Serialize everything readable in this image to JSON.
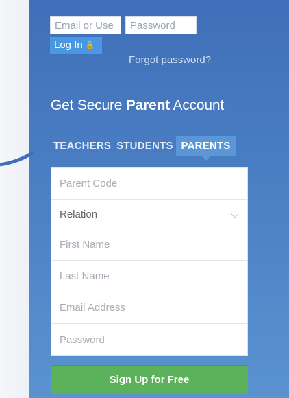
{
  "login": {
    "email_placeholder": "Email or Use",
    "password_placeholder": "Password",
    "login_label": "Log In",
    "lock_icon": "lock-icon",
    "forgot_label": "Forgot password?"
  },
  "heading": {
    "prefix": "Get Secure ",
    "emphasis": "Parent",
    "suffix": " Account"
  },
  "tabs": [
    {
      "label": "TEACHERS",
      "active": false
    },
    {
      "label": "STUDENTS",
      "active": false
    },
    {
      "label": "PARENTS",
      "active": true
    }
  ],
  "form": {
    "parent_code_placeholder": "Parent Code",
    "relation_value": "Relation",
    "first_name_placeholder": "First Name",
    "last_name_placeholder": "Last Name",
    "email_placeholder": "Email Address",
    "password_placeholder": "Password",
    "submit_label": "Sign Up for Free"
  },
  "colors": {
    "background": "#4a7fc4",
    "active_tab": "#5b97d6",
    "login_button": "#4a97e2",
    "signup_button": "#5cb25a"
  }
}
